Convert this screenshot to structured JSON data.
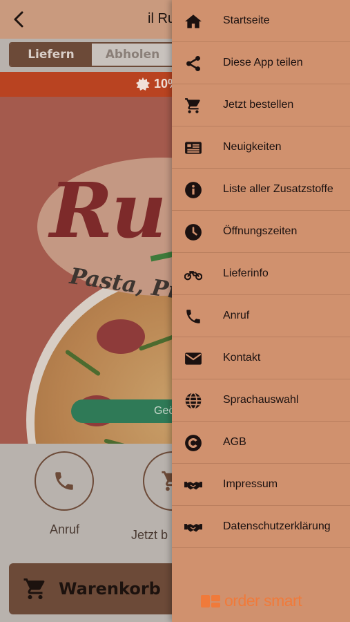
{
  "header": {
    "title": "il Ru"
  },
  "order_mode": {
    "tabs": [
      "Liefern",
      "Abholen"
    ],
    "selected": "Liefern"
  },
  "promo": {
    "text": "10%"
  },
  "hero": {
    "logo_text": "Ru",
    "subtitle": "Pasta, Piz",
    "status_button": "Geö"
  },
  "actions": [
    {
      "label": "Anruf",
      "icon": "phone-icon"
    },
    {
      "label": "Jetzt b",
      "icon": "cart-icon"
    }
  ],
  "cart": {
    "label": "Warenkorb"
  },
  "drawer": {
    "items": [
      {
        "label": "Startseite",
        "icon": "home-icon"
      },
      {
        "label": "Diese App teilen",
        "icon": "share-icon"
      },
      {
        "label": "Jetzt bestellen",
        "icon": "cart-icon"
      },
      {
        "label": "Neuigkeiten",
        "icon": "news-icon"
      },
      {
        "label": "Liste aller Zusatzstoffe",
        "icon": "info-icon"
      },
      {
        "label": "Öffnungszeiten",
        "icon": "clock-icon"
      },
      {
        "label": "Lieferinfo",
        "icon": "motorcycle-icon"
      },
      {
        "label": "Anruf",
        "icon": "phone-icon"
      },
      {
        "label": "Kontakt",
        "icon": "envelope-icon"
      },
      {
        "label": "Sprachauswahl",
        "icon": "globe-icon"
      },
      {
        "label": "AGB",
        "icon": "copyright-icon"
      },
      {
        "label": "Impressum",
        "icon": "handshake-icon"
      },
      {
        "label": "Datenschutzerklärung",
        "icon": "handshake-icon"
      }
    ],
    "brand": "order smart"
  },
  "colors": {
    "drawer_bg": "#d0916e",
    "accent_brown": "#6c4a38",
    "promo_red": "#b94321",
    "brand_orange": "#f07a3a"
  }
}
